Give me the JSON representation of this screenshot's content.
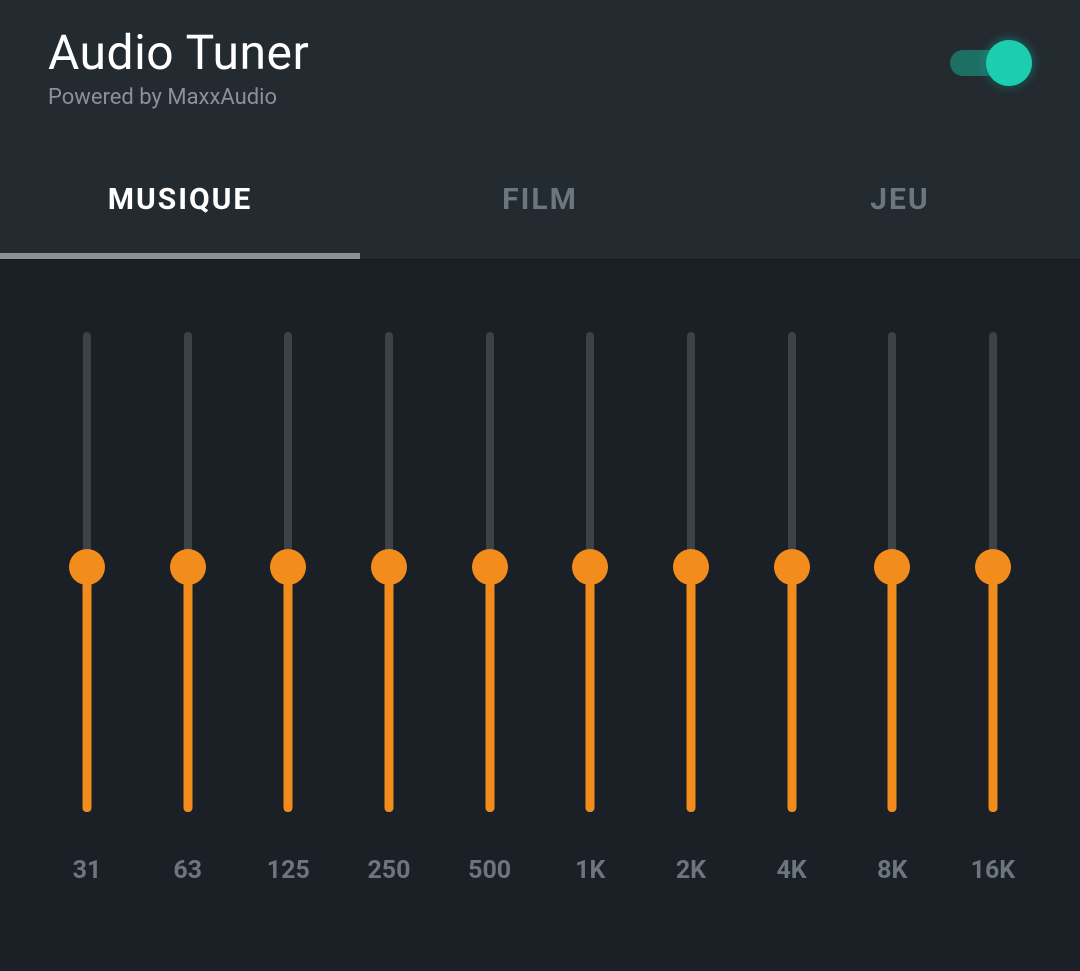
{
  "header": {
    "title": "Audio Tuner",
    "subtitle": "Powered by MaxxAudio",
    "toggle": {
      "on": true
    }
  },
  "tabs": [
    {
      "label": "MUSIQUE",
      "active": true
    },
    {
      "label": "FILM",
      "active": false
    },
    {
      "label": "JEU",
      "active": false
    }
  ],
  "equalizer": {
    "bands": [
      {
        "freq": "31",
        "value": 0
      },
      {
        "freq": "63",
        "value": 0
      },
      {
        "freq": "125",
        "value": 0
      },
      {
        "freq": "250",
        "value": 0
      },
      {
        "freq": "500",
        "value": 0
      },
      {
        "freq": "1K",
        "value": 0
      },
      {
        "freq": "2K",
        "value": 0
      },
      {
        "freq": "4K",
        "value": 0
      },
      {
        "freq": "8K",
        "value": 0
      },
      {
        "freq": "16K",
        "value": 0
      }
    ]
  },
  "colors": {
    "accent": "#f28c1c",
    "toggleOn": "#1dcdb0",
    "bgPanel": "#1a2025",
    "bgHeader": "#232a30"
  }
}
